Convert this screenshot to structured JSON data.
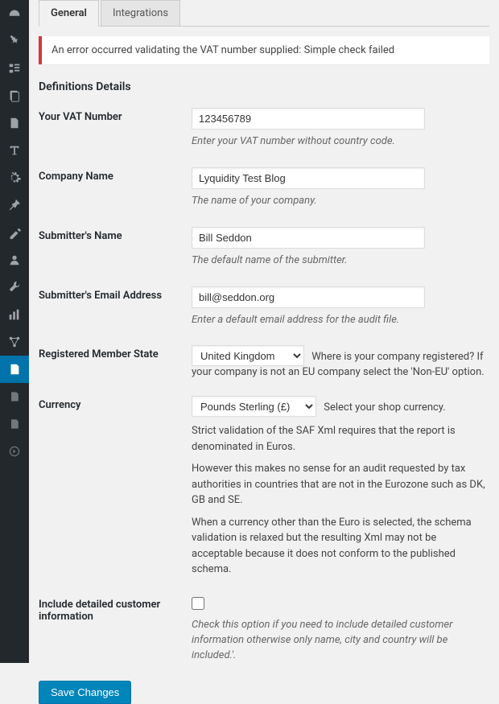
{
  "sidebar": {
    "items": [
      {
        "name": "dashboard"
      },
      {
        "name": "pin"
      },
      {
        "name": "sliders"
      },
      {
        "name": "books"
      },
      {
        "name": "page"
      },
      {
        "name": "text"
      },
      {
        "name": "settings"
      },
      {
        "name": "pin2"
      },
      {
        "name": "brush"
      },
      {
        "name": "user"
      },
      {
        "name": "tools"
      },
      {
        "name": "chart"
      },
      {
        "name": "connections"
      },
      {
        "name": "doc-active"
      },
      {
        "name": "doc1"
      },
      {
        "name": "doc2"
      },
      {
        "name": "play"
      }
    ]
  },
  "tabs": [
    {
      "label": "General",
      "active": true
    },
    {
      "label": "Integrations",
      "active": false
    }
  ],
  "notice": "An error occurred validating the VAT number supplied: Simple check failed",
  "section_title": "Definitions Details",
  "fields": {
    "vat": {
      "label": "Your VAT Number",
      "value": "123456789",
      "help": "Enter your VAT number without country code."
    },
    "company": {
      "label": "Company Name",
      "value": "Lyquidity Test Blog",
      "help": "The name of your company."
    },
    "submitter_name": {
      "label": "Submitter's Name",
      "value": "Bill Seddon",
      "help": "The default name of the submitter."
    },
    "submitter_email": {
      "label": "Submitter's Email Address",
      "value": "bill@seddon.org",
      "help": "Enter a default email address for the audit file."
    },
    "member_state": {
      "label": "Registered Member State",
      "selected": "United Kingdom",
      "inline": "Where is your company registered? If your company is not an EU company select the 'Non-EU' option."
    },
    "currency": {
      "label": "Currency",
      "selected": "Pounds Sterling (£)",
      "inline": "Select your shop currency.",
      "note1": "Strict validation of the SAF Xml requires that the report is denominated in Euros.",
      "note2": "However this makes no sense for an audit requested by tax authorities in countries that are not in the Eurozone such as DK, GB and SE.",
      "note3": "When a currency other than the Euro is selected, the schema validation is relaxed but the resulting Xml may not be acceptable because it does not conform to the published schema."
    },
    "include_detail": {
      "label": "Include detailed customer information",
      "checked": false,
      "help": "Check this option if you need to include detailed customer information otherwise only name, city and country will be included.'."
    }
  },
  "save_button": "Save Changes"
}
